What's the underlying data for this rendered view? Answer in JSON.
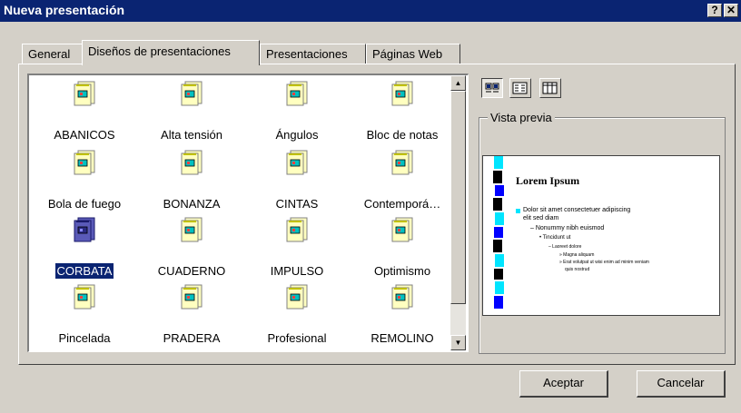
{
  "window": {
    "title": "Nueva presentación",
    "help_button": "?",
    "close_button": "✕"
  },
  "tabs": [
    {
      "label": "General",
      "active": false
    },
    {
      "label": "Diseños de presentaciones",
      "active": true
    },
    {
      "label": "Presentaciones",
      "active": false
    },
    {
      "label": "Páginas Web",
      "active": false
    }
  ],
  "designs": [
    {
      "label": "ABANICOS",
      "selected": false
    },
    {
      "label": "Alta tensión",
      "selected": false
    },
    {
      "label": "Ángulos",
      "selected": false
    },
    {
      "label": "Bloc de notas",
      "selected": false
    },
    {
      "label": "Bola de fuego",
      "selected": false
    },
    {
      "label": "BONANZA",
      "selected": false
    },
    {
      "label": "CINTAS",
      "selected": false
    },
    {
      "label": "Contemporá…",
      "selected": false
    },
    {
      "label": "CORBATA",
      "selected": true
    },
    {
      "label": "CUADERNO",
      "selected": false
    },
    {
      "label": "IMPULSO",
      "selected": false
    },
    {
      "label": "Optimismo",
      "selected": false
    },
    {
      "label": "Pincelada",
      "selected": false
    },
    {
      "label": "PRADERA",
      "selected": false
    },
    {
      "label": "Profesional",
      "selected": false
    },
    {
      "label": "REMOLINO",
      "selected": false
    }
  ],
  "view_buttons": [
    {
      "icon": "large-icons-view-icon",
      "pressed": true
    },
    {
      "icon": "list-view-icon",
      "pressed": false
    },
    {
      "icon": "details-view-icon",
      "pressed": false
    }
  ],
  "preview": {
    "label": "Vista previa",
    "slide_title": "Lorem Ipsum",
    "lines": [
      "Dolor sit amet consectetuer adipiscing",
      "elit sed diam",
      "– Nonummy nibh euismod",
      "• Tincidunt ut",
      "– Laoreet dolore",
      "» Magna aliquam",
      "» Erat volutpat ut wisi enim ad minim veniam",
      "quis nostrud"
    ]
  },
  "buttons": {
    "ok": "Aceptar",
    "cancel": "Cancelar"
  },
  "colors": {
    "titlebar": "#0a2472",
    "dialog": "#d4d0c8",
    "accent_cyan": "#00e5ff",
    "selection": "#0a2472"
  }
}
